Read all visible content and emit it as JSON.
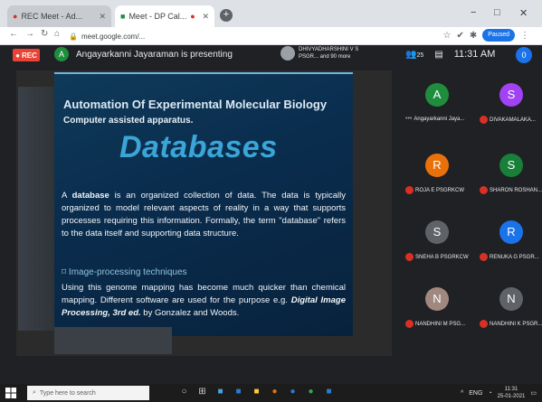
{
  "browser": {
    "tabs": [
      {
        "label": "REC  Meet - Ad...",
        "recording": true
      },
      {
        "label": "Meet - DP Cal...",
        "recording": false
      }
    ],
    "new_tab_symbol": "+",
    "window_controls": [
      "−",
      "□",
      "✕"
    ],
    "url": "meet.google.com/...",
    "profile_label": "Paused"
  },
  "meet": {
    "rec_label": "REC",
    "presenter_initial": "A",
    "presenting_text": "Angayarkanni Jayaraman is presenting",
    "others_text": "DHIVYADHARSHINI V S PSGR... and 90 more",
    "people_count": "25",
    "clock": "11:31 AM",
    "self_initial": "0"
  },
  "slide": {
    "heading": "Automation Of Experimental Molecular Biology",
    "subheading": "Computer assisted apparatus.",
    "title": "Databases",
    "para1_prefix": "A ",
    "para1_bold": "database",
    "para1_rest": " is an organized collection of data. The data is typically organized to model relevant aspects of reality in a way that supports processes requiring this information. Formally, the term \"database\" refers to the data itself and supporting data structure.",
    "section": "Image-processing techniques",
    "para2_start": "Using this genome mapping has become much quicker than chemical mapping. Different software are used for the purpose e.g. ",
    "para2_bold": "Digital Image Processing, 3rd ed.",
    "para2_end": " by Gonzalez and Woods."
  },
  "participants": [
    {
      "initial": "A",
      "name": "Angayarkanni Jaya...",
      "color": "#1e8e3e",
      "muted": false
    },
    {
      "initial": "S",
      "name": "DIVAKAMALAKA...",
      "color": "#a142f4",
      "muted": true
    },
    {
      "initial": "R",
      "name": "ROJA E PSGRKCW",
      "color": "#e8710a",
      "muted": true
    },
    {
      "initial": "S",
      "name": "SHARON ROSHAN...",
      "color": "#188038",
      "muted": true
    },
    {
      "initial": "S",
      "name": "SNEHA B PSGRKCW",
      "color": "#5f6368",
      "muted": true
    },
    {
      "initial": "R",
      "name": "RENUKA G PSGR...",
      "color": "#1a73e8",
      "muted": true
    },
    {
      "initial": "N",
      "name": "NANDHINI M PSG...",
      "color": "#a1887f",
      "muted": true
    },
    {
      "initial": "N",
      "name": "NANDHINI K PSGR...",
      "color": "#5f6368",
      "muted": true
    }
  ],
  "taskbar": {
    "search_placeholder": "Type here to search",
    "time": "11:31",
    "date": "25-01-2021",
    "lang": "ENG"
  }
}
